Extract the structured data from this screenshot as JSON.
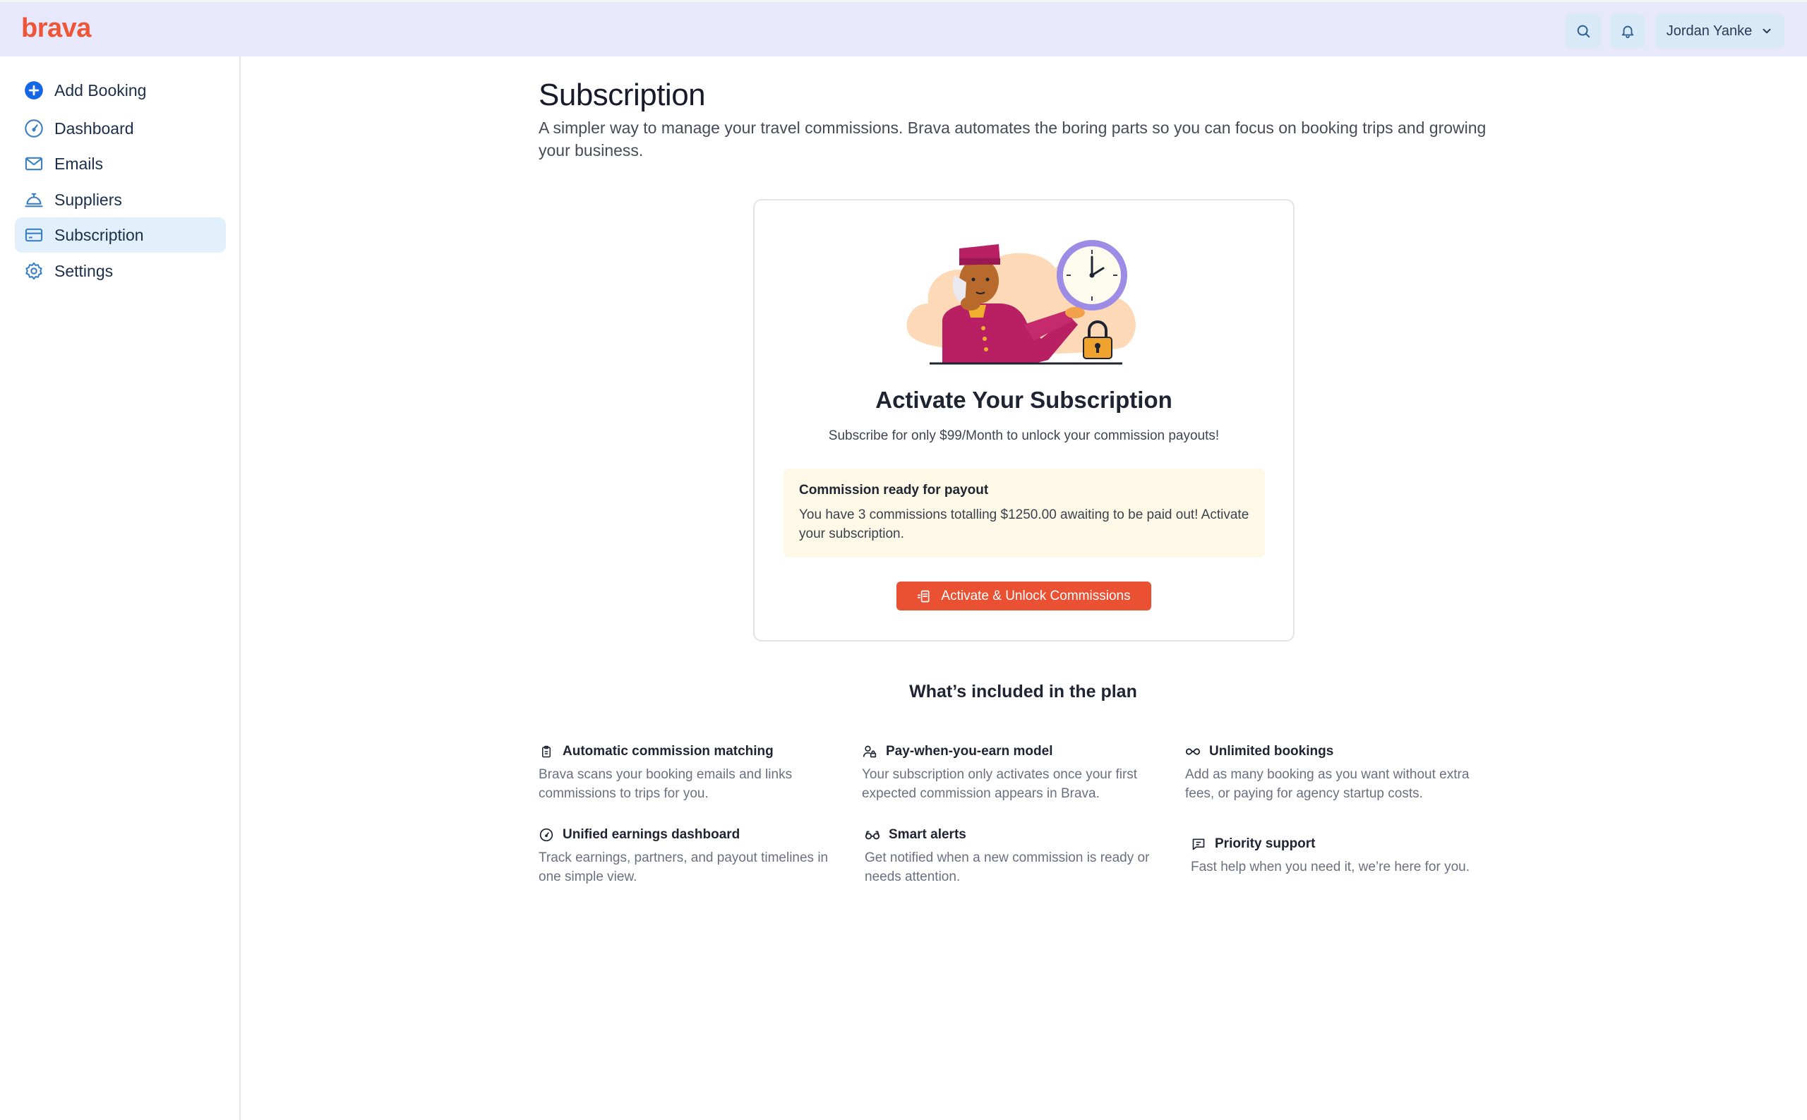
{
  "app": {
    "logo": "brava"
  },
  "header": {
    "user_name": "Jordan Yanke",
    "search_icon": "search-icon",
    "bell_icon": "bell-icon"
  },
  "sidebar": {
    "items": [
      {
        "label": "Add Booking",
        "icon": "plus-circle-icon",
        "active": false
      },
      {
        "label": "Dashboard",
        "icon": "gauge-icon",
        "active": false
      },
      {
        "label": "Emails",
        "icon": "mail-icon",
        "active": false
      },
      {
        "label": "Suppliers",
        "icon": "service-bell-icon",
        "active": false
      },
      {
        "label": "Subscription",
        "icon": "credit-card-icon",
        "active": true
      },
      {
        "label": "Settings",
        "icon": "gear-icon",
        "active": false
      }
    ]
  },
  "main": {
    "title": "Subscription",
    "description": "A simpler way to manage your travel commissions. Brava automates the boring parts so you can focus on booking trips and growing your business."
  },
  "card": {
    "title": "Activate Your Subscription",
    "subtitle": "Subscribe for only $99/Month to unlock your commission payouts!",
    "notice_title": "Commission ready for payout",
    "notice_text": "You have 3 commissions totalling $1250.00 awaiting to be paid out! Activate your subscription.",
    "cta_label": "Activate & Unlock Commissions"
  },
  "plan": {
    "title": "What’s included in the plan",
    "features": [
      {
        "title": "Automatic commission matching",
        "desc": "Brava scans your booking emails and links commissions to trips for you.",
        "icon": "clipboard-icon"
      },
      {
        "title": "Pay-when-you-earn model",
        "desc": "Your subscription only activates once your first expected commission appears in Brava.",
        "icon": "user-lock-icon"
      },
      {
        "title": "Unlimited bookings",
        "desc": "Add as many booking as you want without extra fees, or paying for agency startup costs.",
        "icon": "infinity-icon"
      },
      {
        "title": "Unified earnings dashboard",
        "desc": "Track earnings, partners, and payout timelines in one simple view.",
        "icon": "gauge-icon"
      },
      {
        "title": "Smart alerts",
        "desc": "Get notified when a new commission is ready or needs attention.",
        "icon": "glasses-icon"
      },
      {
        "title": "Priority support",
        "desc": "Fast help when you need it, we’re here for you.",
        "icon": "message-icon"
      }
    ]
  },
  "colors": {
    "brand": "#ee5537",
    "header_bg": "#e7e8fb",
    "active_nav_bg": "#e2f0fc",
    "cta_bg": "#ea5133",
    "notice_bg": "#fdf9e6"
  }
}
